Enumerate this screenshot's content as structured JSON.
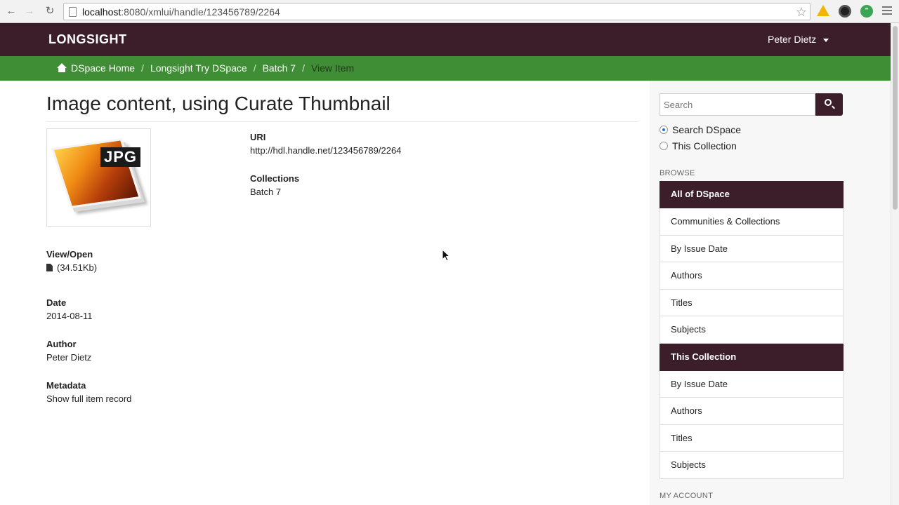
{
  "browser": {
    "url_host": "localhost",
    "url_path": ":8080/xmlui/handle/123456789/2264"
  },
  "header": {
    "brand": "LONGSIGHT",
    "user": "Peter Dietz"
  },
  "breadcrumb": {
    "items": [
      "DSpace Home",
      "Longsight Try DSpace",
      "Batch 7"
    ],
    "current": "View Item",
    "separator": "/"
  },
  "item": {
    "title": "Image content, using Curate Thumbnail",
    "thumbnail_label": "JPG",
    "uri_label": "URI",
    "uri_value": "http://hdl.handle.net/123456789/2264",
    "collections_label": "Collections",
    "collections_value": "Batch 7",
    "view_open_label": "View/Open",
    "file_size": "(34.51Kb)",
    "date_label": "Date",
    "date_value": "2014-08-11",
    "author_label": "Author",
    "author_value": "Peter Dietz",
    "metadata_label": "Metadata",
    "metadata_link": "Show full item record"
  },
  "sidebar": {
    "search_placeholder": "Search",
    "scope_options": [
      "Search DSpace",
      "This Collection"
    ],
    "browse_heading": "BROWSE",
    "all_heading": "All of DSpace",
    "all_items": [
      "Communities & Collections",
      "By Issue Date",
      "Authors",
      "Titles",
      "Subjects"
    ],
    "collection_heading": "This Collection",
    "collection_items": [
      "By Issue Date",
      "Authors",
      "Titles",
      "Subjects"
    ],
    "account_heading": "MY ACCOUNT"
  },
  "colors": {
    "header_bg": "#3b1e29",
    "breadcrumb_bg": "#3f8e35"
  }
}
